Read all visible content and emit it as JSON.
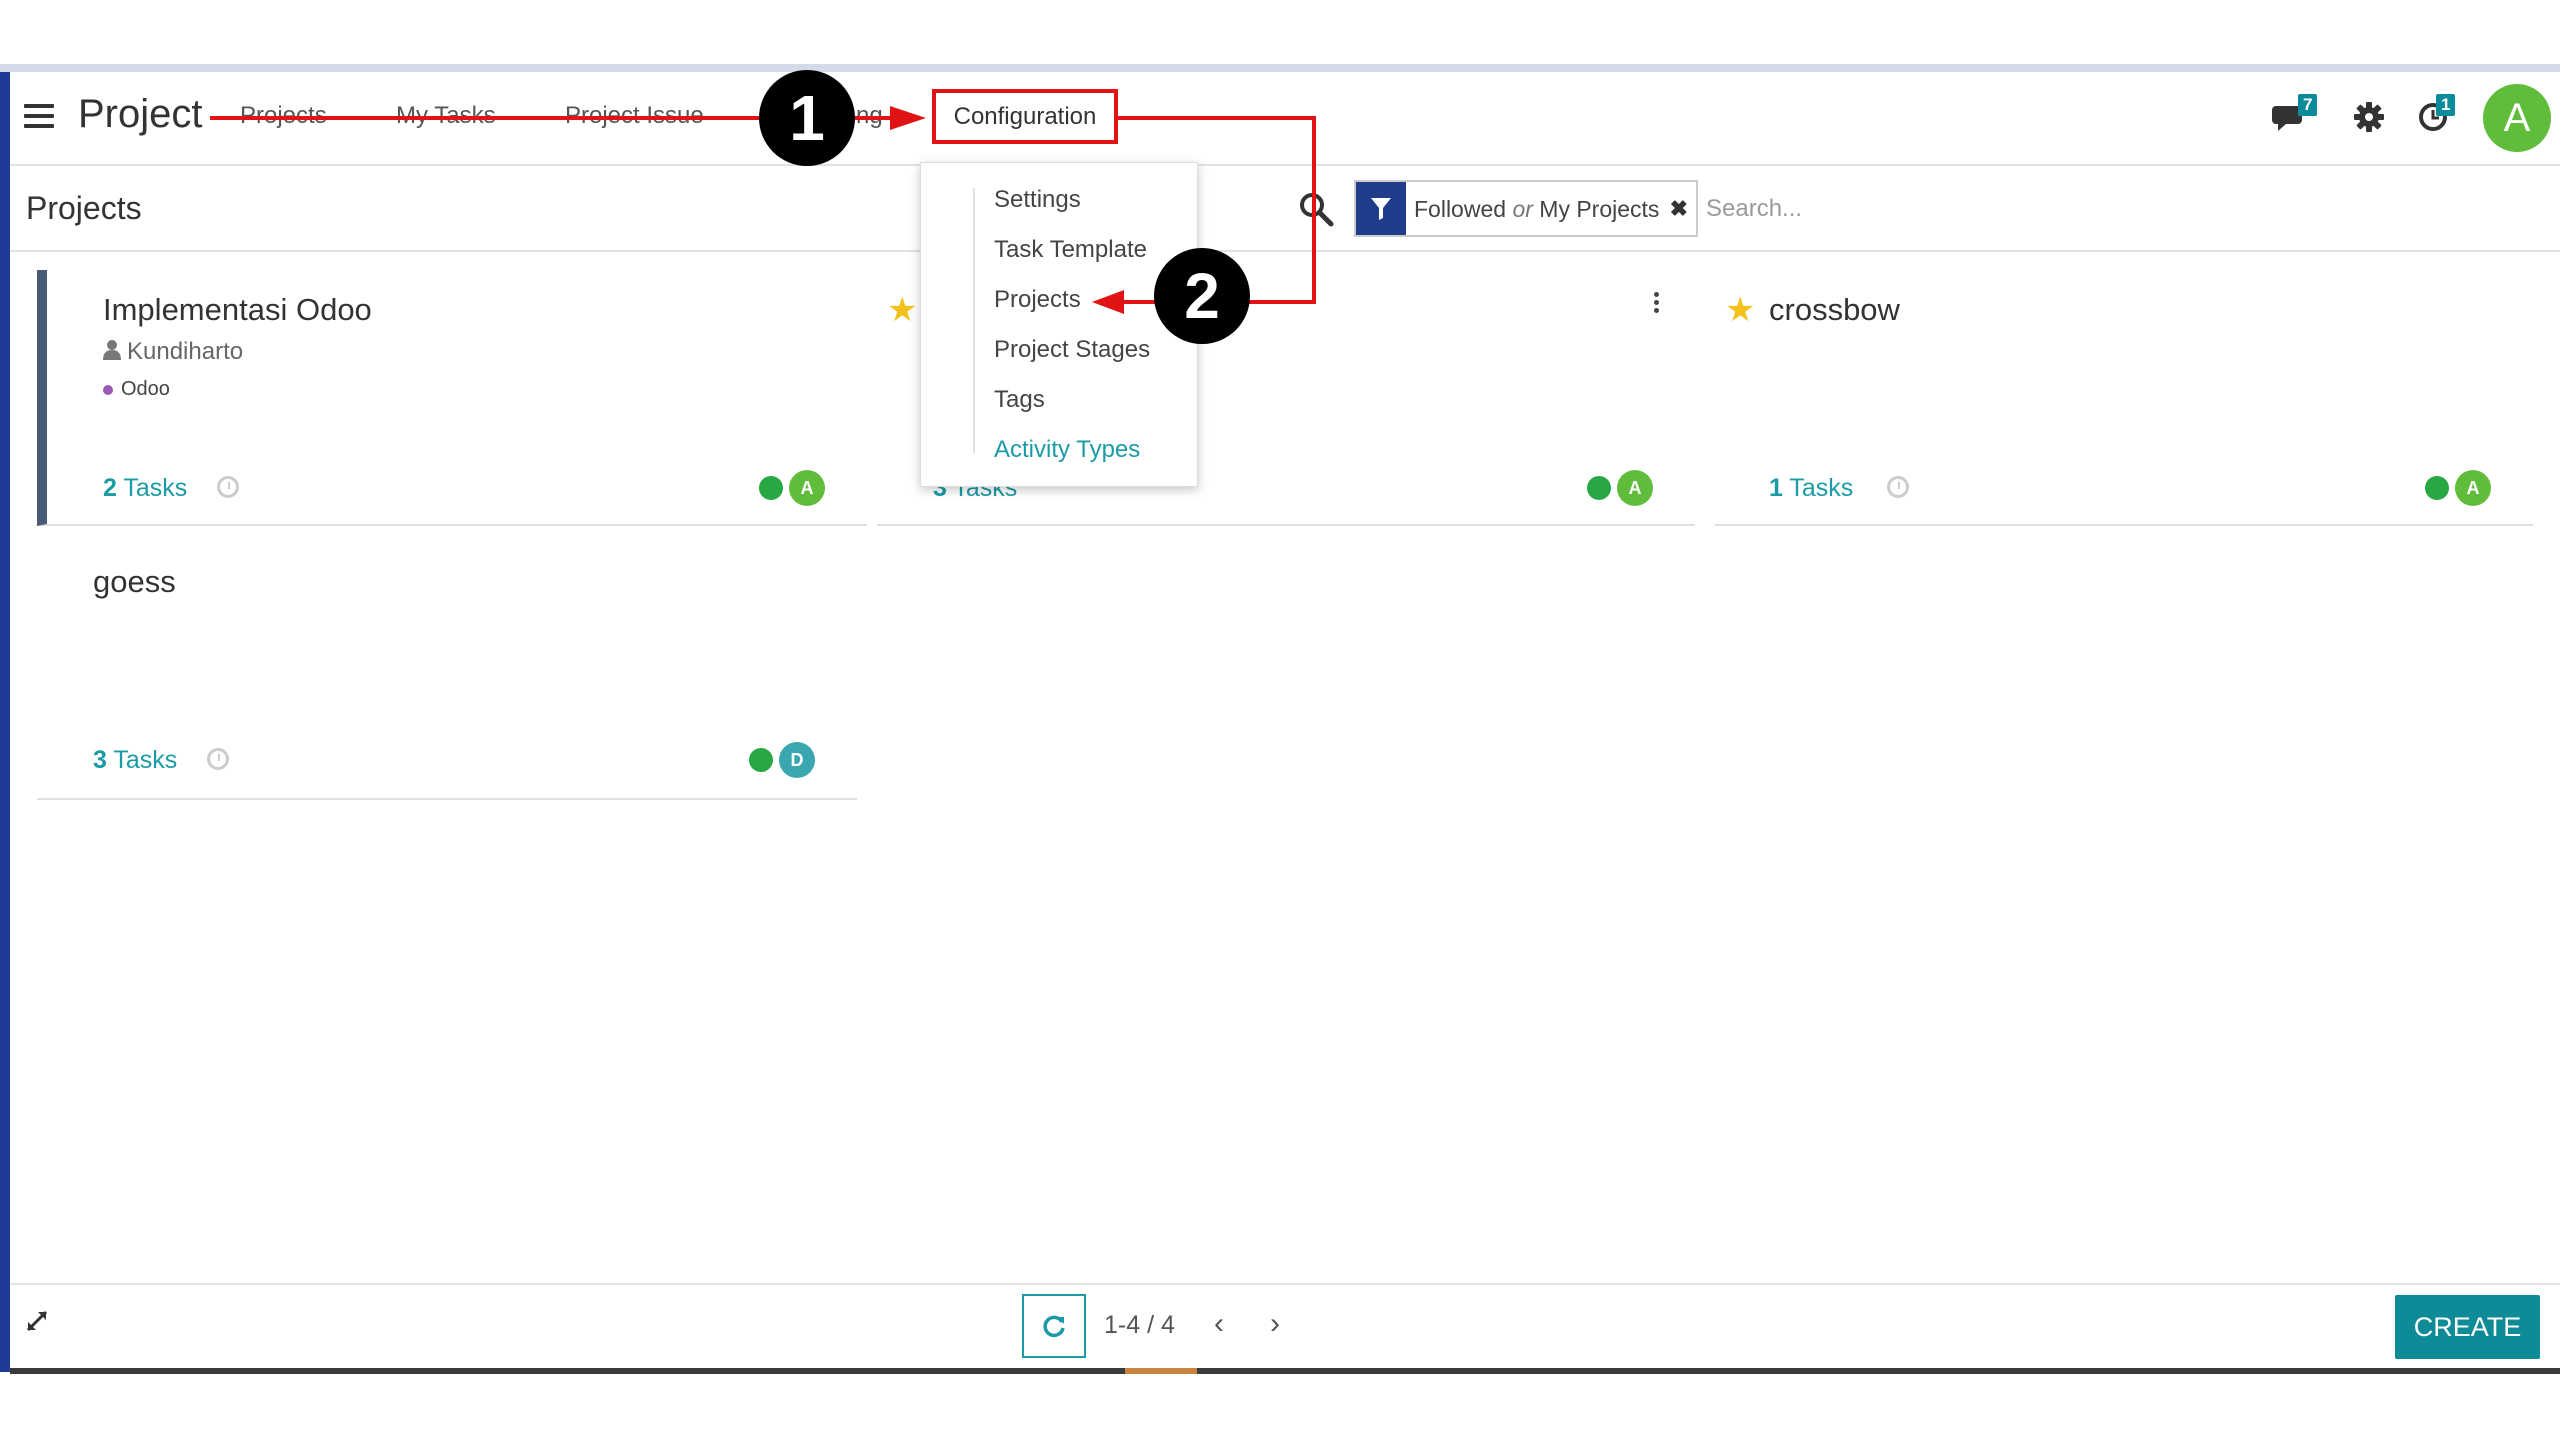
{
  "app": {
    "name": "Project"
  },
  "menu": {
    "items": [
      "Projects",
      "My Tasks",
      "Project Issue",
      "ng",
      "Configuration"
    ]
  },
  "systray": {
    "messages_badge": "7",
    "activity_badge": "1",
    "user_initial": "A"
  },
  "breadcrumb": "Projects",
  "search": {
    "facet_part1": "Followed",
    "facet_or": "or",
    "facet_part2": "My Projects",
    "placeholder": "Search..."
  },
  "config_menu": {
    "items": [
      "Settings",
      "Task Template",
      "Projects",
      "Project Stages",
      "Tags",
      "Activity Types"
    ],
    "active": "Activity Types"
  },
  "projects": [
    {
      "name": "Implementasi Odoo",
      "owner": "Kundiharto",
      "tag": "Odoo",
      "task_count": "2",
      "task_label": "Tasks",
      "favorite": false,
      "status": "green",
      "user_initial": "A",
      "user_color": "#5fbd3b"
    },
    {
      "name": "",
      "task_count": "3",
      "task_label": "Tasks",
      "favorite": true,
      "status": "green",
      "user_initial": "A",
      "user_color": "#5fbd3b"
    },
    {
      "name": "crossbow",
      "task_count": "1",
      "task_label": "Tasks",
      "favorite": true,
      "status": "green",
      "user_initial": "A",
      "user_color": "#5fbd3b"
    },
    {
      "name": "goess",
      "task_count": "3",
      "task_label": "Tasks",
      "favorite": false,
      "status": "green",
      "user_initial": "D",
      "user_color": "#3aa6b0"
    }
  ],
  "annotations": {
    "step1": "1",
    "step2": "2"
  },
  "pager": {
    "value": "1-4 / 4"
  },
  "buttons": {
    "create": "CREATE"
  },
  "colors": {
    "accent": "#1a9ba6",
    "annotation_red": "#e01414",
    "navbar_left": "#1e3c96",
    "create_button": "#0f8b97",
    "star": "#f3c11b"
  }
}
